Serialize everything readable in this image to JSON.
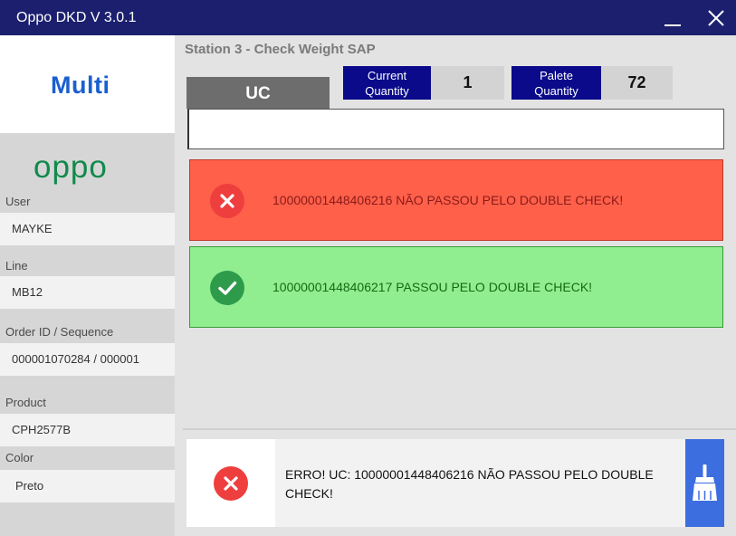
{
  "window": {
    "title": "Oppo DKD V 3.0.1",
    "minimize_icon": "minimize-icon",
    "close_icon": "close-icon"
  },
  "sidebar": {
    "logo_multi": "Multi",
    "logo_oppo": "oppo",
    "fields": [
      {
        "label": "User",
        "value": "MAYKE"
      },
      {
        "label": "Line",
        "value": "MB12"
      },
      {
        "label": "Order ID / Sequence",
        "value": "000001070284 / 000001"
      },
      {
        "label": "Product",
        "value": "CPH2577B"
      },
      {
        "label": "Color",
        "value": "Preto"
      }
    ]
  },
  "main": {
    "station_title": "Station 3 - Check Weight SAP",
    "uc_tab": "UC",
    "uc_input": {
      "value": "",
      "placeholder": ""
    },
    "current_quantity": {
      "label_line1": "Current",
      "label_line2": "Quantity",
      "value": "1"
    },
    "palete_quantity": {
      "label_line1": "Palete",
      "label_line2": "Quantity",
      "value": "72"
    },
    "messages": [
      {
        "status": "error",
        "icon": "x-circle-icon",
        "text": "10000001448406216 NÃO PASSOU PELO DOUBLE CHECK!"
      },
      {
        "status": "success",
        "icon": "check-circle-icon",
        "text": "10000001448406217 PASSOU PELO DOUBLE CHECK!"
      }
    ],
    "footer": {
      "icon": "x-circle-icon",
      "text": "ERRO! UC: 10000001448406216 NÃO PASSOU PELO DOUBLE CHECK!",
      "clear_icon": "broom-icon"
    }
  },
  "colors": {
    "titlebar": "#1b1f6e",
    "quantity_label_bg": "#0a0a8a",
    "error_bg": "#fe604a",
    "success_bg": "#90ee90",
    "clear_button": "#3d6ee0",
    "oppo_green": "#118a4b",
    "multi_blue": "#1a5fd0"
  }
}
